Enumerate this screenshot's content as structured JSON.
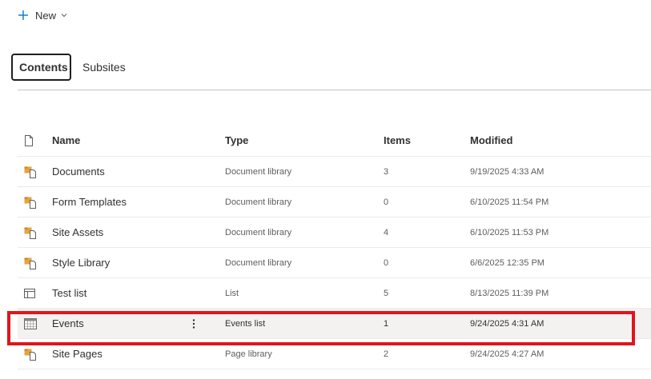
{
  "toolbar": {
    "new_label": "New"
  },
  "tabs": [
    {
      "label": "Contents",
      "active": true
    },
    {
      "label": "Subsites",
      "active": false
    }
  ],
  "table": {
    "headers": {
      "name": "Name",
      "type": "Type",
      "items": "Items",
      "modified": "Modified"
    },
    "rows": [
      {
        "icon": "library-icon",
        "name": "Documents",
        "type": "Document library",
        "items": "3",
        "modified": "9/19/2025 4:33 AM"
      },
      {
        "icon": "library-icon",
        "name": "Form Templates",
        "type": "Document library",
        "items": "0",
        "modified": "6/10/2025 11:54 PM"
      },
      {
        "icon": "library-icon",
        "name": "Site Assets",
        "type": "Document library",
        "items": "4",
        "modified": "6/10/2025 11:53 PM"
      },
      {
        "icon": "library-icon",
        "name": "Style Library",
        "type": "Document library",
        "items": "0",
        "modified": "6/6/2025 12:35 PM"
      },
      {
        "icon": "list-icon",
        "name": "Test list",
        "type": "List",
        "items": "5",
        "modified": "8/13/2025 11:39 PM"
      },
      {
        "icon": "calendar-icon",
        "name": "Events",
        "type": "Events list",
        "items": "1",
        "modified": "9/24/2025 4:31 AM"
      },
      {
        "icon": "library-icon",
        "name": "Site Pages",
        "type": "Page library",
        "items": "2",
        "modified": "9/24/2025 4:27 AM"
      }
    ]
  },
  "colors": {
    "accent": "#0078d4",
    "highlight_border": "#e0151c",
    "folder": "#e8a33d",
    "row_hover": "#f3f2f1"
  }
}
